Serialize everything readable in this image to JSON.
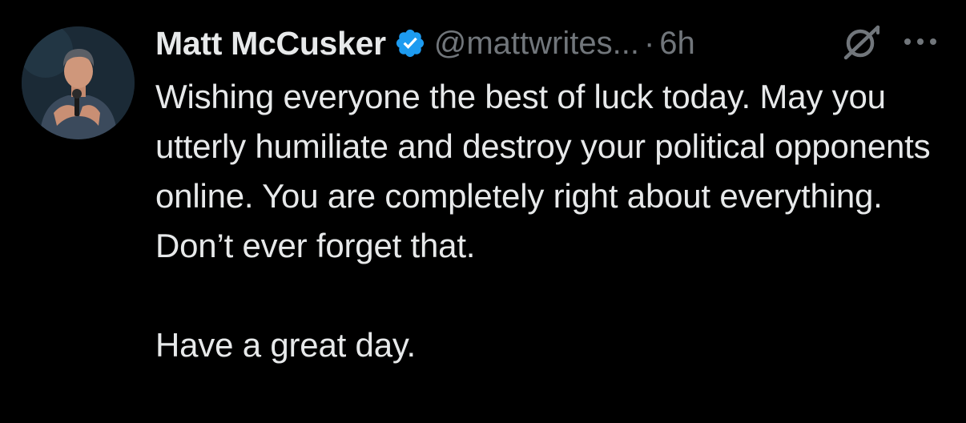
{
  "tweet": {
    "author": {
      "display_name": "Matt McCusker",
      "handle": "@mattwrites...",
      "verified": true,
      "avatar_icon": "avatar-photo"
    },
    "separator": "·",
    "timestamp": "6h",
    "grok_icon": "grok-icon",
    "more_icon": "more-options-icon",
    "text_paragraphs": [
      "Wishing everyone the best of luck today. May you utterly humiliate and destroy your political opponents online. You are completely right about everything. Don’t ever forget that.",
      "Have a great day."
    ]
  },
  "colors": {
    "background": "#000000",
    "text_primary": "#e7e9ea",
    "text_secondary": "#71767b",
    "verified_badge": "#1d9bf0"
  }
}
